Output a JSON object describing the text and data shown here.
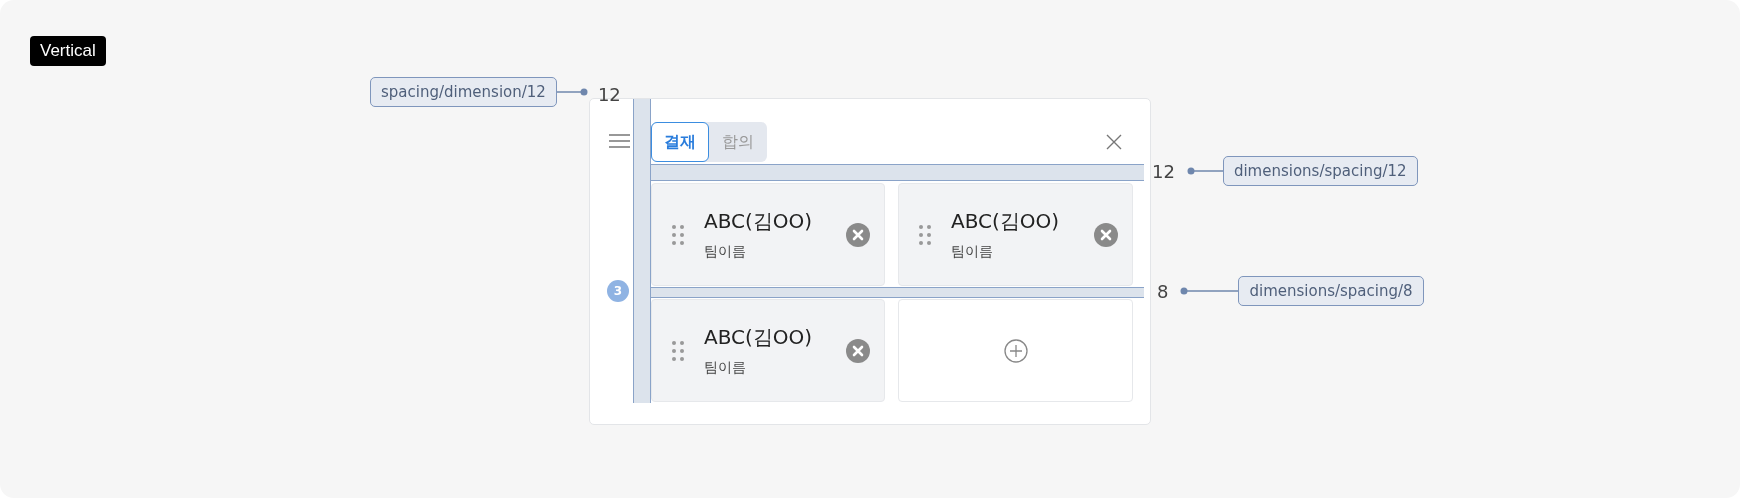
{
  "badge": "Vertical",
  "panel": {
    "tabs": [
      {
        "label": "결재",
        "selected": true
      },
      {
        "label": "합의",
        "selected": false
      }
    ],
    "count": "3",
    "cards": [
      {
        "kind": "person",
        "name": "ABC(김OO)",
        "team": "팀이름"
      },
      {
        "kind": "person",
        "name": "ABC(김OO)",
        "team": "팀이름"
      },
      {
        "kind": "person",
        "name": "ABC(김OO)",
        "team": "팀이름"
      },
      {
        "kind": "add"
      }
    ]
  },
  "annotations": [
    {
      "label": "spacing/dimension/12",
      "value": "12"
    },
    {
      "label": "dimensions/spacing/12",
      "value": "12"
    },
    {
      "label": "dimensions/spacing/8",
      "value": "8"
    }
  ]
}
